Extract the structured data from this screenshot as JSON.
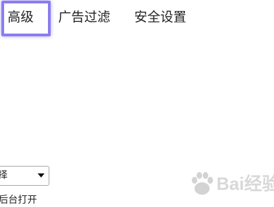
{
  "tabs": {
    "advanced": "高级",
    "ad_filter": "广告过滤",
    "security": "安全设置"
  },
  "highlight": {
    "color": "#8b7cf0",
    "target": "advanced"
  },
  "dropdown": {
    "value": "择",
    "arrow_icon": "caret-down-icon"
  },
  "option": {
    "text": "后台打开"
  },
  "watermark": {
    "text": "Bai经验",
    "icon": "paw-icon"
  }
}
